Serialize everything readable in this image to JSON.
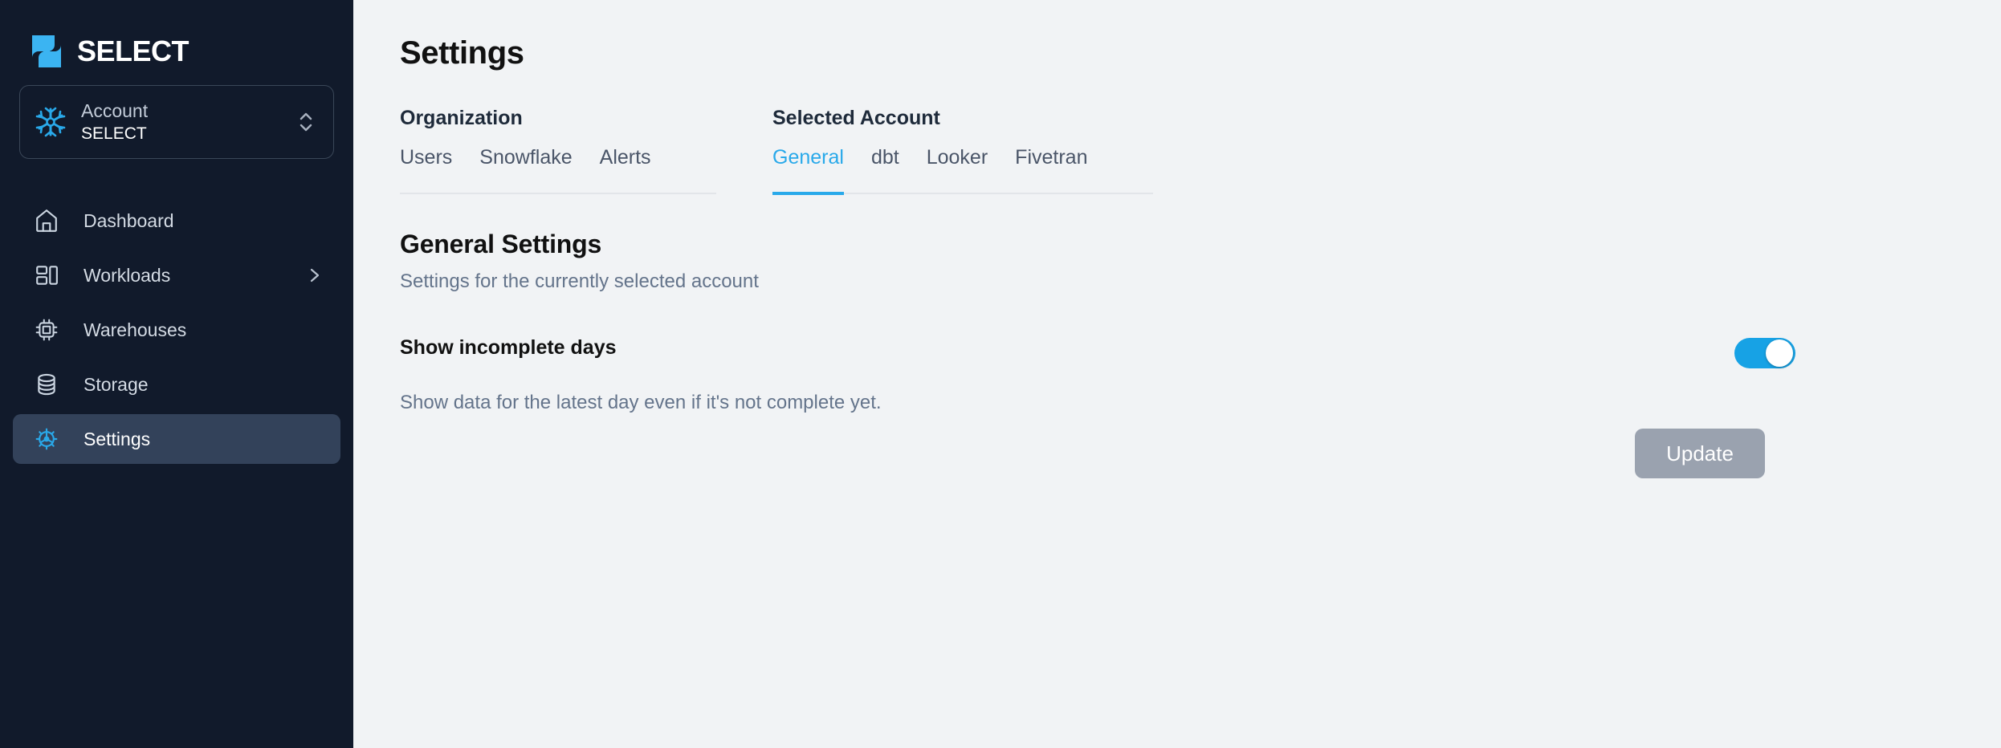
{
  "brand": {
    "name": "SELECT",
    "logo_icon": "select-s-logo",
    "accent_color": "#29A9EA"
  },
  "sidebar": {
    "account_selector": {
      "icon": "snowflake-icon",
      "label": "Account",
      "value": "SELECT",
      "chevron_icon": "chevron-up-down-icon"
    },
    "items": [
      {
        "label": "Dashboard",
        "icon": "home-icon",
        "active": false,
        "has_chevron": false
      },
      {
        "label": "Workloads",
        "icon": "layout-icon",
        "active": false,
        "has_chevron": true
      },
      {
        "label": "Warehouses",
        "icon": "cpu-chip-icon",
        "active": false,
        "has_chevron": false
      },
      {
        "label": "Storage",
        "icon": "database-icon",
        "active": false,
        "has_chevron": false
      },
      {
        "label": "Settings",
        "icon": "gear-icon",
        "active": true,
        "has_chevron": false
      }
    ]
  },
  "main": {
    "page_title": "Settings",
    "tab_groups": [
      {
        "title": "Organization",
        "tabs": [
          {
            "label": "Users",
            "active": false
          },
          {
            "label": "Snowflake",
            "active": false
          },
          {
            "label": "Alerts",
            "active": false
          }
        ]
      },
      {
        "title": "Selected Account",
        "tabs": [
          {
            "label": "General",
            "active": true
          },
          {
            "label": "dbt",
            "active": false
          },
          {
            "label": "Looker",
            "active": false
          },
          {
            "label": "Fivetran",
            "active": false
          }
        ]
      }
    ],
    "section": {
      "title": "General Settings",
      "subtitle": "Settings for the currently selected account"
    },
    "setting": {
      "label": "Show incomplete days",
      "description": "Show data for the latest day even if it's not complete yet.",
      "toggle_on": true,
      "toggle_color": "#17A2E5"
    },
    "update_button": {
      "label": "Update",
      "enabled": false,
      "color": "#9AA2AF"
    }
  }
}
